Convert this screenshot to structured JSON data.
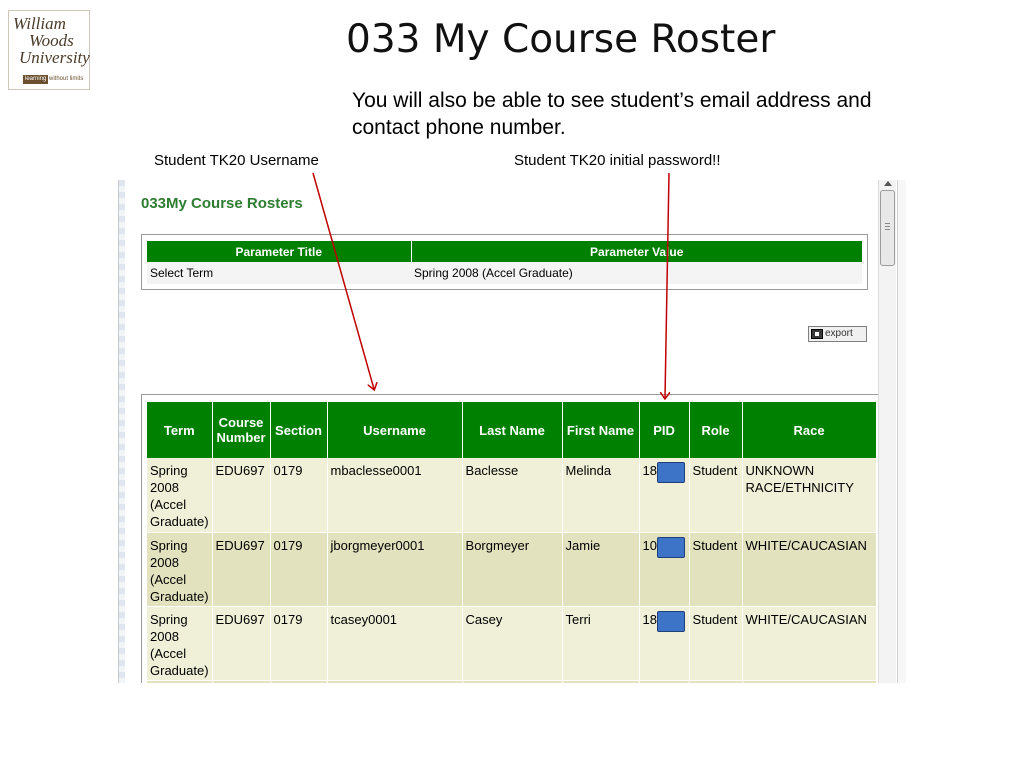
{
  "logo": {
    "line1": "William",
    "line2": "Woods",
    "line3": "University",
    "tag_left": "learning",
    "tag_right": "without limits"
  },
  "slide": {
    "title": "033 My Course Roster",
    "subtitle": "You will also be able to see student’s email address and contact phone number.",
    "annotation_username": "Student TK20 Username",
    "annotation_password": "Student TK20 initial password!!"
  },
  "page": {
    "heading": "033My Course Rosters",
    "export_label": "export"
  },
  "parameters": {
    "headers": [
      "Parameter Title",
      "Parameter Value"
    ],
    "rows": [
      {
        "title": "Select Term",
        "value": "Spring 2008 (Accel Graduate)"
      }
    ]
  },
  "roster": {
    "headers": [
      "Term",
      "Course Number",
      "Section",
      "Username",
      "Last Name",
      "First Name",
      "PID",
      "Role",
      "Race"
    ],
    "rows": [
      {
        "term": "Spring 2008 (Accel Graduate)",
        "course": "EDU697",
        "section": "0179",
        "username": "mbaclesse0001",
        "last": "Baclesse",
        "first": "Melinda",
        "pid": "18",
        "role": "Student",
        "race": "UNKNOWN RACE/ETHNICITY"
      },
      {
        "term": "Spring 2008 (Accel Graduate)",
        "course": "EDU697",
        "section": "0179",
        "username": "jborgmeyer0001",
        "last": "Borgmeyer",
        "first": "Jamie",
        "pid": "10",
        "role": "Student",
        "race": "WHITE/CAUCASIAN"
      },
      {
        "term": "Spring 2008 (Accel Graduate)",
        "course": "EDU697",
        "section": "0179",
        "username": "tcasey0001",
        "last": "Casey",
        "first": "Terri",
        "pid": "18",
        "role": "Student",
        "race": "WHITE/CAUCASIAN"
      }
    ]
  },
  "colors": {
    "header_green": "#008000",
    "heading_green": "#2e7d32",
    "row_odd": "#f0f0d8",
    "row_even": "#e2e2bf",
    "arrow_red": "#c00000",
    "redaction_blue": "#3e74c7"
  }
}
